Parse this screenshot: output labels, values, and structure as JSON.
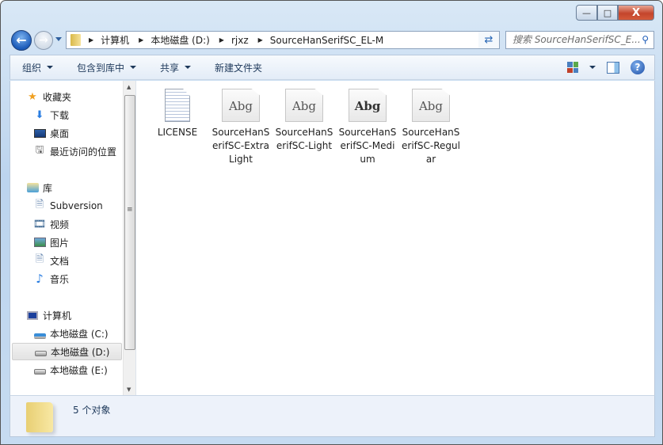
{
  "window": {
    "minimize_label": "—",
    "maximize_label": "□",
    "close_label": "X"
  },
  "address": {
    "segments": [
      "计算机",
      "本地磁盘 (D:)",
      "rjxz",
      "SourceHanSerifSC_EL-M"
    ]
  },
  "search": {
    "placeholder": "搜索 SourceHanSerifSC_E..."
  },
  "toolbar": {
    "organize": "组织",
    "include_in_library": "包含到库中",
    "share": "共享",
    "new_folder": "新建文件夹",
    "help": "?"
  },
  "nav": {
    "favorites": {
      "label": "收藏夹",
      "items": [
        "下载",
        "桌面",
        "最近访问的位置"
      ]
    },
    "libraries": {
      "label": "库",
      "items": [
        "Subversion",
        "视频",
        "图片",
        "文档",
        "音乐"
      ]
    },
    "computer": {
      "label": "计算机",
      "items": [
        "本地磁盘 (C:)",
        "本地磁盘 (D:)",
        "本地磁盘 (E:)"
      ],
      "selected": "本地磁盘 (D:)"
    }
  },
  "files": [
    {
      "name": "LICENSE",
      "type": "text"
    },
    {
      "name": "SourceHanSerifSC-ExtraLight",
      "type": "font",
      "preview": "Abg"
    },
    {
      "name": "SourceHanSerifSC-Light",
      "type": "font",
      "preview": "Abg"
    },
    {
      "name": "SourceHanSerifSC-Medium",
      "type": "font",
      "preview": "Abg"
    },
    {
      "name": "SourceHanSerifSC-Regular",
      "type": "font",
      "preview": "Abg"
    }
  ],
  "status": {
    "count_text": "5 个对象"
  }
}
